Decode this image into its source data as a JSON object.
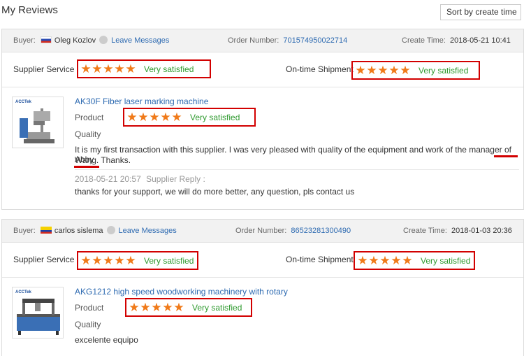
{
  "page": {
    "title": "My Reviews",
    "sort_label": "Sort by create time"
  },
  "labels": {
    "buyer": "Buyer:",
    "leave_messages": "Leave Messages",
    "order_number": "Order Number:",
    "create_time": "Create Time:",
    "supplier_service": "Supplier Service",
    "ontime_shipment": "On-time Shipment",
    "product": "Product",
    "quality": "Quality",
    "very_satisfied": "Very satisfied",
    "supplier_reply": "Supplier Reply :"
  },
  "reviews": [
    {
      "buyer_name": "Oleg Kozlov",
      "order_number": "701574950022714",
      "create_time": "2018-05-21 10:41",
      "product_name": "AK30F Fiber laser marking machine",
      "comment": "It is my first transaction with this supplier. I was very pleased with quality of the equipment and work of the manager of Abby",
      "comment_line2": "Wang. Thanks.",
      "reply_time": "2018-05-21 20:57",
      "reply_text": "thanks for your support, we will do more better, any question, pls contact us",
      "logo": "ACCTek",
      "supplier_service_stars": 5,
      "ontime_shipment_stars": 5,
      "product_stars": 5
    },
    {
      "buyer_name": "carlos sislema",
      "order_number": "86523281300490",
      "create_time": "2018-01-03 20:36",
      "product_name": "AKG1212 high speed woodworking machinery with rotary",
      "comment": "excelente equipo",
      "logo": "ACCTek",
      "supplier_service_stars": 5,
      "ontime_shipment_stars": 5,
      "product_stars": 5
    }
  ],
  "colors": {
    "accent_link": "#2d6ab1",
    "star": "#f07a19",
    "satisfied": "#2f9a2f",
    "highlight_box": "#d20000"
  },
  "icons": {
    "star": "star-icon",
    "flag_ru": "russia-flag-icon",
    "flag_ec": "ecuador-flag-icon",
    "avatar": "avatar-circle-icon"
  }
}
